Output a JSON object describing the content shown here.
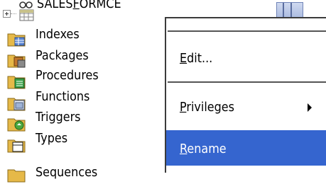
{
  "tree": {
    "root": {
      "label_prefix": "SALES",
      "label_mnemonic": "F",
      "label_suffix": "ORMCE",
      "icon": "database-connection-icon"
    },
    "items": [
      {
        "label": "Indexes",
        "icon": "indexes-folder-icon"
      },
      {
        "label": "Packages",
        "icon": "packages-folder-icon"
      },
      {
        "label": "Procedures",
        "icon": "procedures-folder-icon"
      },
      {
        "label": "Functions",
        "icon": "functions-folder-icon"
      },
      {
        "label": "Triggers",
        "icon": "triggers-folder-icon"
      },
      {
        "label": "Types",
        "icon": "types-folder-icon"
      },
      {
        "label": "Sequences",
        "icon": "sequences-folder-icon"
      }
    ]
  },
  "context_menu": {
    "items": [
      {
        "mnemonic": "E",
        "rest": "dit...",
        "has_submenu": false,
        "selected": false
      },
      {
        "mnemonic": "P",
        "rest": "rivileges",
        "has_submenu": true,
        "selected": false
      },
      {
        "mnemonic": "R",
        "rest": "ename",
        "has_submenu": false,
        "selected": true
      }
    ]
  },
  "colors": {
    "selection": "#3565cf",
    "folder": "#e6b948"
  }
}
